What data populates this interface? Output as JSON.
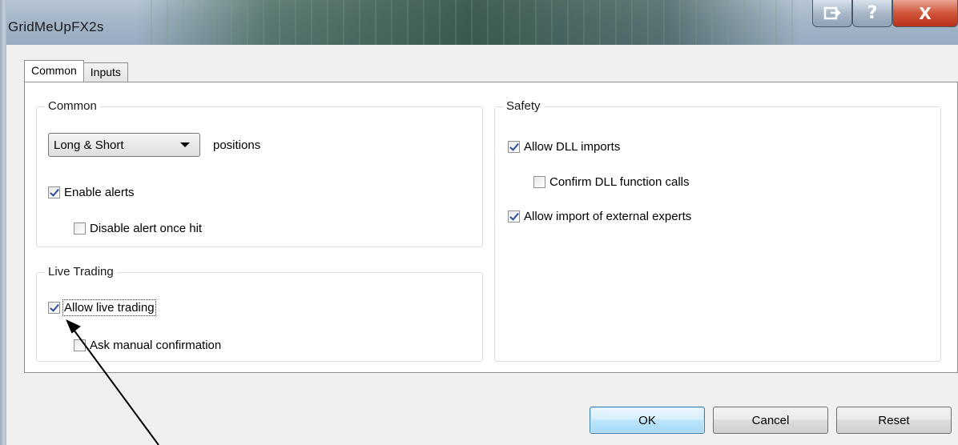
{
  "window": {
    "title": "GridMeUpFX2s",
    "help_glyph": "?",
    "close_glyph": "X"
  },
  "tabs": [
    {
      "label": "Common",
      "active": true
    },
    {
      "label": "Inputs",
      "active": false
    }
  ],
  "common_group": {
    "label": "Common",
    "positions_select": {
      "selected": "Long & Short",
      "suffix": "positions"
    },
    "enable_alerts": {
      "label": "Enable alerts",
      "checked": true
    },
    "disable_alert_once_hit": {
      "label": "Disable alert once hit",
      "checked": false
    }
  },
  "live_group": {
    "label": "Live Trading",
    "allow_live_trading": {
      "label": "Allow live trading",
      "checked": true
    },
    "ask_manual_confirmation": {
      "label": "Ask manual confirmation",
      "checked": false
    }
  },
  "safety_group": {
    "label": "Safety",
    "allow_dll_imports": {
      "label": "Allow DLL imports",
      "checked": true
    },
    "confirm_dll_calls": {
      "label": "Confirm DLL function calls",
      "checked": false
    },
    "allow_external_experts": {
      "label": "Allow import of external experts",
      "checked": true
    }
  },
  "buttons": {
    "ok": "OK",
    "cancel": "Cancel",
    "reset": "Reset"
  },
  "colors": {
    "accent_check": "#2b4f9e",
    "close_button": "#d0553a",
    "default_button_border": "#3c7fb1"
  }
}
